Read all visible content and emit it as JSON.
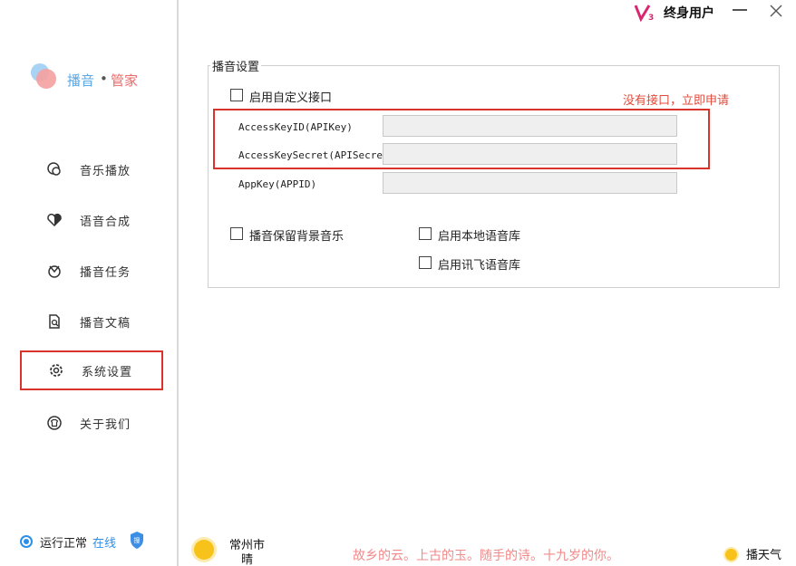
{
  "header": {
    "user_label": "终身用户",
    "brand_icon": "v3-logo-icon"
  },
  "logo": {
    "text_left": "播音",
    "separator": "•",
    "text_right": "管家"
  },
  "sidebar": {
    "items": [
      {
        "label": "音乐播放",
        "icon": "music-icon"
      },
      {
        "label": "语音合成",
        "icon": "heart-icon"
      },
      {
        "label": "播音任务",
        "icon": "task-icon"
      },
      {
        "label": "播音文稿",
        "icon": "document-search-icon"
      },
      {
        "label": "系统设置",
        "icon": "gear-icon",
        "active": true
      },
      {
        "label": "关于我们",
        "icon": "shirt-icon"
      }
    ]
  },
  "status": {
    "text": "运行正常",
    "online": "在线"
  },
  "settings": {
    "group_title": "播音设置",
    "custom_api_label": "启用自定义接口",
    "hint": "没有接口，立即申请",
    "fields": [
      {
        "label": "AccessKeyID(APIKey)",
        "value": ""
      },
      {
        "label": "AccessKeySecret(APISecret)",
        "value": ""
      },
      {
        "label": "AppKey(APPID)",
        "value": ""
      }
    ],
    "keep_bg_music_label": "播音保留背景音乐",
    "local_voice_label": "启用本地语音库",
    "xunfei_voice_label": "启用讯飞语音库"
  },
  "footer": {
    "city": "常州市",
    "condition": "晴",
    "poem": "故乡的云。上古的玉。随手的诗。十九岁的你。",
    "weather_button": "播天气"
  },
  "colors": {
    "accent_blue": "#2b8fe8",
    "highlight_red": "#d9342b",
    "hint_red": "#e24a3b",
    "poem_pink": "#f08a8a"
  }
}
